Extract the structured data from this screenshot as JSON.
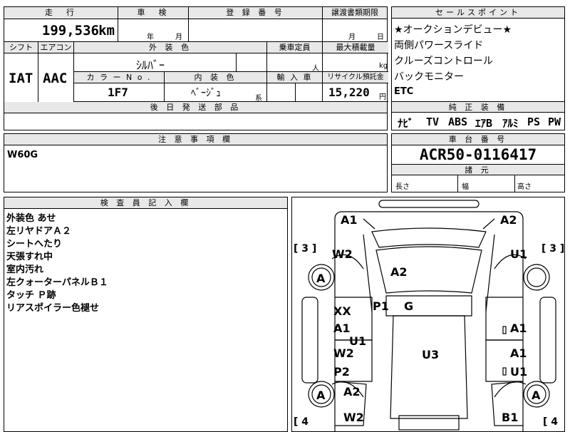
{
  "top": {
    "mileage_header": "走　行",
    "mileage_value": "199,536",
    "mileage_unit": "km",
    "inspection_header": "車　検",
    "inspection_year_unit": "年",
    "inspection_month_unit": "月",
    "registration_header": "登 録 番 号",
    "transfer_header": "譲渡書類期限",
    "transfer_month_unit": "月",
    "transfer_day_unit": "日"
  },
  "specs": {
    "shift_header": "シフト",
    "shift_value": "IAT",
    "aircon_header": "エアコン",
    "aircon_value": "AAC",
    "exterior_header": "外 装 色",
    "exterior_value": "ｼﾙﾊﾞｰ",
    "capacity_header": "乗車定員",
    "capacity_unit": "人",
    "max_load_header": "最大積載量",
    "max_load_unit": "kg",
    "color_no_header": "カ ラ ー N o .",
    "color_no_value": "1F7",
    "interior_header": "内 装 色",
    "interior_value": "ﾍﾞｰｼﾞｭ",
    "interior_suffix": "系",
    "import_header": "輸 入 車",
    "recycle_header": "リサイクル預託金",
    "recycle_value": "15,220",
    "recycle_unit": "円",
    "parts_header": "後 日 発 送 部 品"
  },
  "selling_points": {
    "header": "セールスポイント",
    "items": [
      "★オークションデビュー★",
      "両側パワースライド",
      "クルーズコントロール",
      "バックモニター",
      "ETC"
    ]
  },
  "equipment": {
    "header": "純 正 装 備",
    "items": [
      "ﾅﾋﾞ",
      "TV",
      "ABS",
      "ｴｱB",
      "ｱﾙﾐ",
      "PS",
      "PW"
    ]
  },
  "notes": {
    "header": "注 意 事 項 欄",
    "value": "W60G"
  },
  "chassis": {
    "header": "車 台 番 号",
    "value": "ACR50-0116417",
    "specs_header": "諸 元",
    "length_label": "長さ",
    "width_label": "幅",
    "height_label": "高さ"
  },
  "inspector": {
    "header": "検 査 員 記 入 欄",
    "lines": [
      "外装色 あせ",
      "左リヤドアＡ２",
      "シートへたり",
      "天張すれ中",
      "室内汚れ",
      "左クォーターパネルＢ１",
      "タッチ Ｐ跡",
      "リアスポイラー色褪せ"
    ]
  },
  "diagram": {
    "marks": [
      "A1",
      "A2",
      "W2",
      "U1",
      "A",
      "A2",
      "XX",
      "A1",
      "U1",
      "P1",
      "G",
      "A1",
      "W2",
      "A1",
      "P2",
      "U1",
      "U3",
      "A",
      "A2",
      "A",
      "W2",
      "B1",
      "A1",
      "A1"
    ],
    "brackets": [
      "[ 3 ]",
      "[ 3 ]",
      "[ 4",
      "[ 4"
    ]
  }
}
